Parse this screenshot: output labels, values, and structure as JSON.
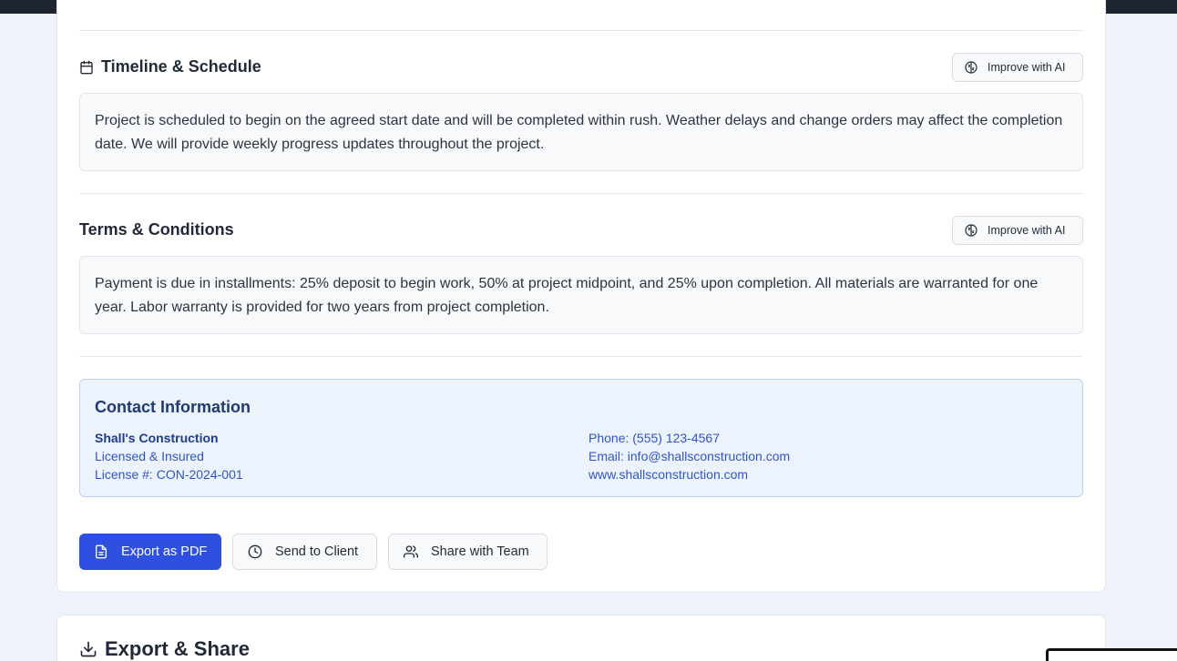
{
  "timeline": {
    "title": "Timeline & Schedule",
    "ai_button": "Improve with AI",
    "text": "Project is scheduled to begin on the agreed start date and will be completed within rush. Weather delays and change orders may affect the completion date. We will provide weekly progress updates throughout the project."
  },
  "terms": {
    "title": "Terms & Conditions",
    "ai_button": "Improve with AI",
    "text": "Payment is due in installments: 25% deposit to begin work, 50% at project midpoint, and 25% upon completion. All materials are warranted for one year. Labor warranty is provided for two years from project completion."
  },
  "contact": {
    "title": "Contact Information",
    "company": "Shall's Construction",
    "licensed": "Licensed & Insured",
    "license": "License #: CON-2024-001",
    "phone": "Phone: (555) 123-4567",
    "email": "Email: info@shallsconstruction.com",
    "website": "www.shallsconstruction.com"
  },
  "actions": {
    "export_pdf": "Export as PDF",
    "send_client": "Send to Client",
    "share_team": "Share with Team"
  },
  "export_share": {
    "title": "Export & Share"
  }
}
